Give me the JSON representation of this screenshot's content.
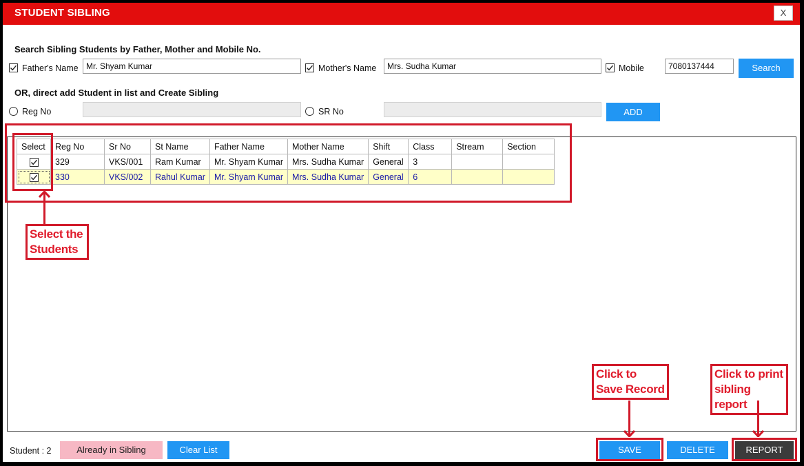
{
  "window": {
    "title": "STUDENT SIBLING",
    "close_label": "X"
  },
  "search": {
    "heading": "Search Sibling Students by Father, Mother and Mobile No.",
    "father_label": "Father's Name",
    "father_value": "Mr. Shyam Kumar",
    "father_checked": true,
    "mother_label": "Mother's Name",
    "mother_value": "Mrs. Sudha Kumar",
    "mother_checked": true,
    "mobile_label": "Mobile",
    "mobile_value": "7080137444",
    "mobile_checked": true,
    "search_button": "Search"
  },
  "direct_add": {
    "heading": "OR, direct add Student in list and Create Sibling",
    "regno_label": "Reg No",
    "regno_value": "",
    "srno_label": "SR No",
    "srno_value": "",
    "add_button": "ADD"
  },
  "grid": {
    "columns": [
      "Select",
      "Reg No",
      "Sr No",
      "St Name",
      "Father Name",
      "Mother Name",
      "Shift",
      "Class",
      "Stream",
      "Section"
    ],
    "rows": [
      {
        "selected": true,
        "reg_no": "329",
        "sr_no": "VKS/001",
        "st_name": "Ram Kumar",
        "father": "Mr. Shyam Kumar",
        "mother": "Mrs. Sudha Kumar",
        "shift": "General",
        "class": "3",
        "stream": "",
        "section": ""
      },
      {
        "selected": true,
        "reg_no": "330",
        "sr_no": "VKS/002",
        "st_name": "Rahul Kumar",
        "father": "Mr. Shyam Kumar",
        "mother": "Mrs. Sudha Kumar",
        "shift": "General",
        "class": "6",
        "stream": "",
        "section": ""
      }
    ]
  },
  "callouts": {
    "select": "Select the Students",
    "save": "Click to Save Record",
    "report": "Click to print sibling report"
  },
  "footer": {
    "student_count": "Student : 2",
    "already_in_sibling": "Already in Sibling",
    "clear_list": "Clear List",
    "save": "SAVE",
    "delete": "DELETE",
    "report": "REPORT"
  },
  "colors": {
    "titlebar": "#e20d0d",
    "accent_blue": "#2196f3",
    "annotation_red": "#d11a2a",
    "selected_row": "#ffffc8",
    "already_in_sibling_bg": "#f7b8c4",
    "report_bg": "#3b3b3b"
  }
}
